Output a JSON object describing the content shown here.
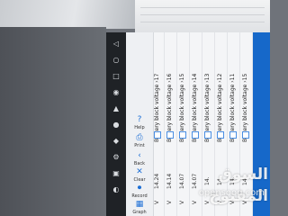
{
  "rows": [
    {
      "name": "Battery block voltage ›15",
      "value": "14.",
      "unit": "V"
    },
    {
      "name": "Battery block voltage ›11",
      "value": "14.",
      "unit": "V"
    },
    {
      "name": "Battery block voltage ›12",
      "value": "14.",
      "unit": "V"
    },
    {
      "name": "Battery block voltage ›13",
      "value": "14.",
      "unit": "V"
    },
    {
      "name": "Battery block voltage ›14",
      "value": "14.07",
      "unit": "V"
    },
    {
      "name": "Battery block voltage ›15",
      "value": "14.07",
      "unit": "V"
    },
    {
      "name": "Battery block voltage ›16",
      "value": "14.14",
      "unit": "V"
    },
    {
      "name": "Battery block voltage ›17",
      "value": "14.24",
      "unit": "V"
    }
  ],
  "tools": [
    {
      "icon": "chevron-icon",
      "label": "Back"
    },
    {
      "icon": "clear-icon",
      "label": "Clear"
    },
    {
      "icon": "record-icon",
      "label": "Record"
    },
    {
      "icon": "graph-icon",
      "label": "Graph"
    },
    {
      "icon": "print-icon",
      "label": "Print"
    },
    {
      "icon": "help-icon",
      "label": "Help"
    }
  ],
  "watermark": {
    "arabic": "السوق المفتوح",
    "latin": "opensooq.com"
  },
  "colors": {
    "accent": "#1668c9",
    "system_bar": "#1f2226"
  }
}
